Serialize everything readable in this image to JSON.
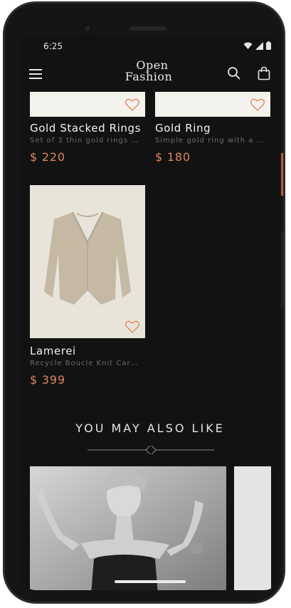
{
  "status": {
    "time": "6:25"
  },
  "header": {
    "logo_line1": "Open",
    "logo_line2": "Fashion"
  },
  "products": [
    {
      "name": "Gold Stacked Rings",
      "description": "Set of 3 thin gold rings …",
      "price": "$ 220"
    },
    {
      "name": "Gold Ring",
      "description": "Simple gold ring with a …",
      "price": "$ 180"
    },
    {
      "name": "Lamerei",
      "description": "Recycle Boucle Knit Car…",
      "price": "$ 399"
    }
  ],
  "section": {
    "title": "YOU MAY ALSO LIKE"
  },
  "colors": {
    "background": "#121212",
    "accent": "#dd8560",
    "text": "#f2f2f2",
    "muted": "#6c6c6c"
  },
  "icons": [
    "menu-icon",
    "search-icon",
    "shopping-bag-icon",
    "heart-icon",
    "wifi-icon",
    "signal-icon",
    "battery-icon"
  ]
}
